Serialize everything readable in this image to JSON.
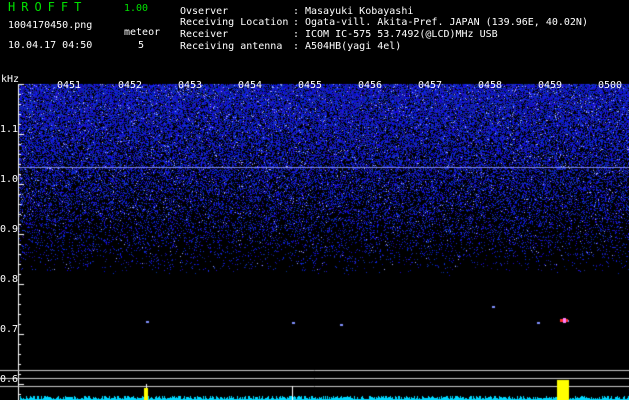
{
  "header": {
    "app_title": "HROFFT",
    "app_version": "1.00",
    "file_name": "1004170450.png",
    "date_time": "10.04.17 04:50",
    "meteor_label": "meteor",
    "meteor_count": "5",
    "info": [
      {
        "key": "Ovserver",
        "value": "Masayuki Kobayashi"
      },
      {
        "key": "Receiving Location",
        "value": "Ogata-vill. Akita-Pref. JAPAN (139.96E, 40.02N)"
      },
      {
        "key": "Receiver",
        "value": "ICOM IC-575 53.7492(@LCD)MHz USB"
      },
      {
        "key": "Receiving antenna",
        "value": "A504HB(yagi 4el)"
      }
    ],
    "separator": ":"
  },
  "plot": {
    "y_unit": "kHz",
    "time_ticks": [
      "0451",
      "0452",
      "0453",
      "0454",
      "0455",
      "0456",
      "0457",
      "0458",
      "0459",
      "0500"
    ],
    "freq_ticks": [
      "1.1",
      "1.0",
      "0.9",
      "0.8",
      "0.7",
      "0.6"
    ],
    "meteor_color": "#ff3030",
    "noise_color": "#2030ff",
    "level_color": "#00d8ff",
    "peak_color": "#ffff00"
  }
}
